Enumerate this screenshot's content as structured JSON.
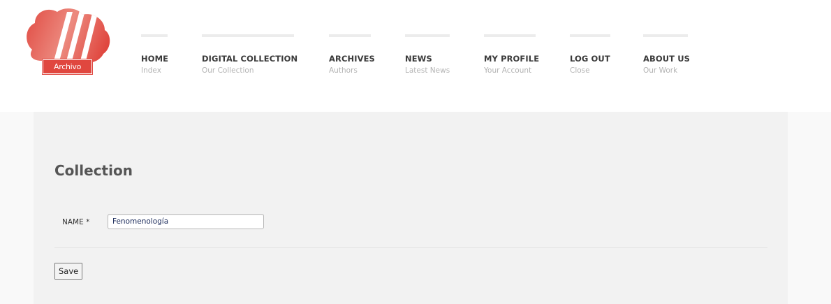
{
  "brand": {
    "logo_text": "Archivo",
    "accent_color": "#e0473f"
  },
  "nav": {
    "items": [
      {
        "label": "HOME",
        "sub": "Index"
      },
      {
        "label": "DIGITAL COLLECTION",
        "sub": "Our Collection"
      },
      {
        "label": "ARCHIVES",
        "sub": "Authors"
      },
      {
        "label": "NEWS",
        "sub": "Latest News"
      },
      {
        "label": "MY PROFILE",
        "sub": "Your Account"
      },
      {
        "label": "LOG OUT",
        "sub": "Close"
      },
      {
        "label": "ABOUT US",
        "sub": "Our Work"
      }
    ]
  },
  "main": {
    "title": "Collection",
    "form": {
      "name_label": "NAME *",
      "name_value": "Fenomenología",
      "save_label": "Save"
    }
  }
}
